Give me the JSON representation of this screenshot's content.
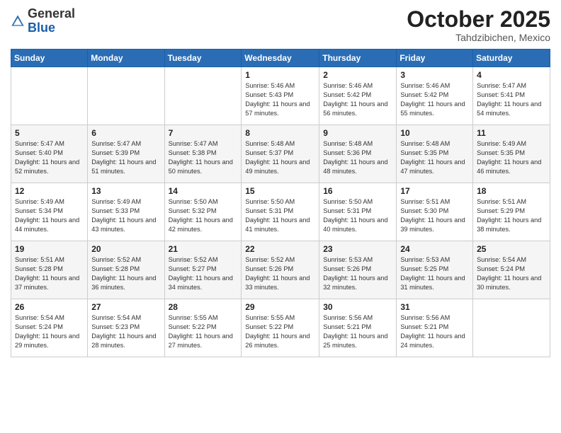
{
  "header": {
    "logo_general": "General",
    "logo_blue": "Blue",
    "month": "October 2025",
    "location": "Tahdzibichen, Mexico"
  },
  "weekdays": [
    "Sunday",
    "Monday",
    "Tuesday",
    "Wednesday",
    "Thursday",
    "Friday",
    "Saturday"
  ],
  "weeks": [
    [
      {
        "day": "",
        "info": ""
      },
      {
        "day": "",
        "info": ""
      },
      {
        "day": "",
        "info": ""
      },
      {
        "day": "1",
        "info": "Sunrise: 5:46 AM\nSunset: 5:43 PM\nDaylight: 11 hours and 57 minutes."
      },
      {
        "day": "2",
        "info": "Sunrise: 5:46 AM\nSunset: 5:42 PM\nDaylight: 11 hours and 56 minutes."
      },
      {
        "day": "3",
        "info": "Sunrise: 5:46 AM\nSunset: 5:42 PM\nDaylight: 11 hours and 55 minutes."
      },
      {
        "day": "4",
        "info": "Sunrise: 5:47 AM\nSunset: 5:41 PM\nDaylight: 11 hours and 54 minutes."
      }
    ],
    [
      {
        "day": "5",
        "info": "Sunrise: 5:47 AM\nSunset: 5:40 PM\nDaylight: 11 hours and 52 minutes."
      },
      {
        "day": "6",
        "info": "Sunrise: 5:47 AM\nSunset: 5:39 PM\nDaylight: 11 hours and 51 minutes."
      },
      {
        "day": "7",
        "info": "Sunrise: 5:47 AM\nSunset: 5:38 PM\nDaylight: 11 hours and 50 minutes."
      },
      {
        "day": "8",
        "info": "Sunrise: 5:48 AM\nSunset: 5:37 PM\nDaylight: 11 hours and 49 minutes."
      },
      {
        "day": "9",
        "info": "Sunrise: 5:48 AM\nSunset: 5:36 PM\nDaylight: 11 hours and 48 minutes."
      },
      {
        "day": "10",
        "info": "Sunrise: 5:48 AM\nSunset: 5:35 PM\nDaylight: 11 hours and 47 minutes."
      },
      {
        "day": "11",
        "info": "Sunrise: 5:49 AM\nSunset: 5:35 PM\nDaylight: 11 hours and 46 minutes."
      }
    ],
    [
      {
        "day": "12",
        "info": "Sunrise: 5:49 AM\nSunset: 5:34 PM\nDaylight: 11 hours and 44 minutes."
      },
      {
        "day": "13",
        "info": "Sunrise: 5:49 AM\nSunset: 5:33 PM\nDaylight: 11 hours and 43 minutes."
      },
      {
        "day": "14",
        "info": "Sunrise: 5:50 AM\nSunset: 5:32 PM\nDaylight: 11 hours and 42 minutes."
      },
      {
        "day": "15",
        "info": "Sunrise: 5:50 AM\nSunset: 5:31 PM\nDaylight: 11 hours and 41 minutes."
      },
      {
        "day": "16",
        "info": "Sunrise: 5:50 AM\nSunset: 5:31 PM\nDaylight: 11 hours and 40 minutes."
      },
      {
        "day": "17",
        "info": "Sunrise: 5:51 AM\nSunset: 5:30 PM\nDaylight: 11 hours and 39 minutes."
      },
      {
        "day": "18",
        "info": "Sunrise: 5:51 AM\nSunset: 5:29 PM\nDaylight: 11 hours and 38 minutes."
      }
    ],
    [
      {
        "day": "19",
        "info": "Sunrise: 5:51 AM\nSunset: 5:28 PM\nDaylight: 11 hours and 37 minutes."
      },
      {
        "day": "20",
        "info": "Sunrise: 5:52 AM\nSunset: 5:28 PM\nDaylight: 11 hours and 36 minutes."
      },
      {
        "day": "21",
        "info": "Sunrise: 5:52 AM\nSunset: 5:27 PM\nDaylight: 11 hours and 34 minutes."
      },
      {
        "day": "22",
        "info": "Sunrise: 5:52 AM\nSunset: 5:26 PM\nDaylight: 11 hours and 33 minutes."
      },
      {
        "day": "23",
        "info": "Sunrise: 5:53 AM\nSunset: 5:26 PM\nDaylight: 11 hours and 32 minutes."
      },
      {
        "day": "24",
        "info": "Sunrise: 5:53 AM\nSunset: 5:25 PM\nDaylight: 11 hours and 31 minutes."
      },
      {
        "day": "25",
        "info": "Sunrise: 5:54 AM\nSunset: 5:24 PM\nDaylight: 11 hours and 30 minutes."
      }
    ],
    [
      {
        "day": "26",
        "info": "Sunrise: 5:54 AM\nSunset: 5:24 PM\nDaylight: 11 hours and 29 minutes."
      },
      {
        "day": "27",
        "info": "Sunrise: 5:54 AM\nSunset: 5:23 PM\nDaylight: 11 hours and 28 minutes."
      },
      {
        "day": "28",
        "info": "Sunrise: 5:55 AM\nSunset: 5:22 PM\nDaylight: 11 hours and 27 minutes."
      },
      {
        "day": "29",
        "info": "Sunrise: 5:55 AM\nSunset: 5:22 PM\nDaylight: 11 hours and 26 minutes."
      },
      {
        "day": "30",
        "info": "Sunrise: 5:56 AM\nSunset: 5:21 PM\nDaylight: 11 hours and 25 minutes."
      },
      {
        "day": "31",
        "info": "Sunrise: 5:56 AM\nSunset: 5:21 PM\nDaylight: 11 hours and 24 minutes."
      },
      {
        "day": "",
        "info": ""
      }
    ]
  ]
}
